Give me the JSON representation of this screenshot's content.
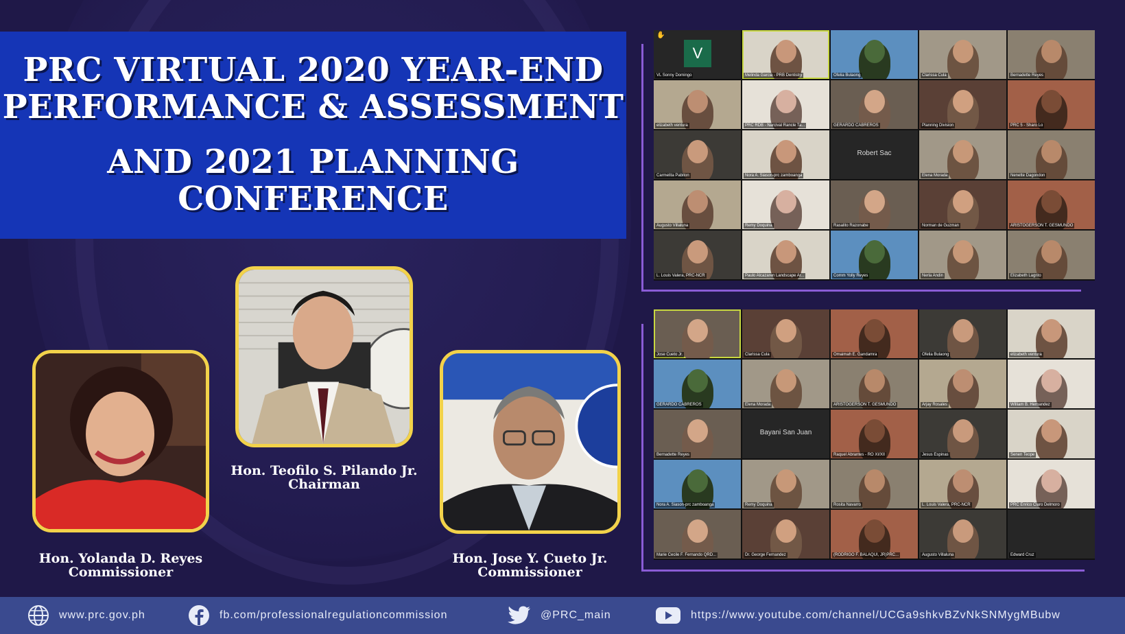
{
  "title": {
    "line1": "PRC VIRTUAL 2020 YEAR-END",
    "line2": "PERFORMANCE & ASSESSMENT",
    "line3": "AND 2021 PLANNING",
    "line4": "CONFERENCE"
  },
  "speakers": [
    {
      "name": "Hon. Yolanda D. Reyes",
      "role": "Commissioner"
    },
    {
      "name": "Hon. Teofilo S. Pilando Jr.",
      "role": "Chairman"
    },
    {
      "name": "Hon. Jose Y. Cueto Jr.",
      "role": "Commissioner"
    }
  ],
  "gallery_top": [
    "VL Sonny Domingo",
    "Melinda Garcia - PRB Dentistry",
    "Ofelia Bulaong",
    "Clarissa Cula",
    "Bernadette Reyes",
    "elizabeth ventura",
    "PRC RDB - Narcival Rancle Ta...",
    "GERARDO CABREROS",
    "Planning Division",
    "PRC 5 - Sharo Lo",
    "Carmelita Pabiton",
    "Nora A. Siason-prc zamboanga",
    "Robert Sac",
    "Elena Morada",
    "Nenette Dagondon",
    "Augusto Villaluna",
    "Remy Doquina",
    "Rasalito Razonabe",
    "Norman de Guzman",
    "ARISTOGERSON T. GESMUNDO",
    "L. Louis Valera, PRC-NCR",
    "Paulo Alcazaren Landscape Ar...",
    "Comm Yolly Reyes",
    "Nerla Andin",
    "Elizabeth Lagrito"
  ],
  "gallery_bottom": [
    "Jose Cueto Jr.",
    "Clarissa Cula",
    "Omaimah E. Gandamra",
    "Ofelia Bulaong",
    "elizabeth ventura",
    "GERARDO CABREROS",
    "Elena Morada",
    "ARISTOGERSON T. GESMUNDO",
    "Arjay Rosales",
    "William B. Hernandez",
    "Bernadette Reyes",
    "Bayani San Juan",
    "Raquel Abrantes - RO XI/XII",
    "Jesus Espinas",
    "Senen Teope",
    "Nora A. Siason-prc zamboanga",
    "Remy Doquina",
    "Rosita Navarro",
    "L. Louis Valera, PRC-NCR",
    "PRC Enrico Claro Delmoro",
    "Marie Cecile F. Fernando QRD...",
    "Dr. George Fernandez",
    "(RODRIGO F. BALAQUI, JR)PRC...",
    "Augusto Villaluna",
    "Edward Cruz"
  ],
  "avatar_letter": "V",
  "footer": {
    "website": "www.prc.gov.ph",
    "facebook": "fb.com/professionalregulationcommission",
    "twitter": "@PRC_main",
    "youtube": "https://www.youtube.com/channel/UCGa9shkvBZvNkSNMygMBubw"
  },
  "colors": {
    "background": "#1f1848",
    "banner": "#1535b6",
    "portrait_border": "#f2d24a",
    "gallery_frame": "#8a5cd6",
    "footer": "#3a4a8f"
  }
}
